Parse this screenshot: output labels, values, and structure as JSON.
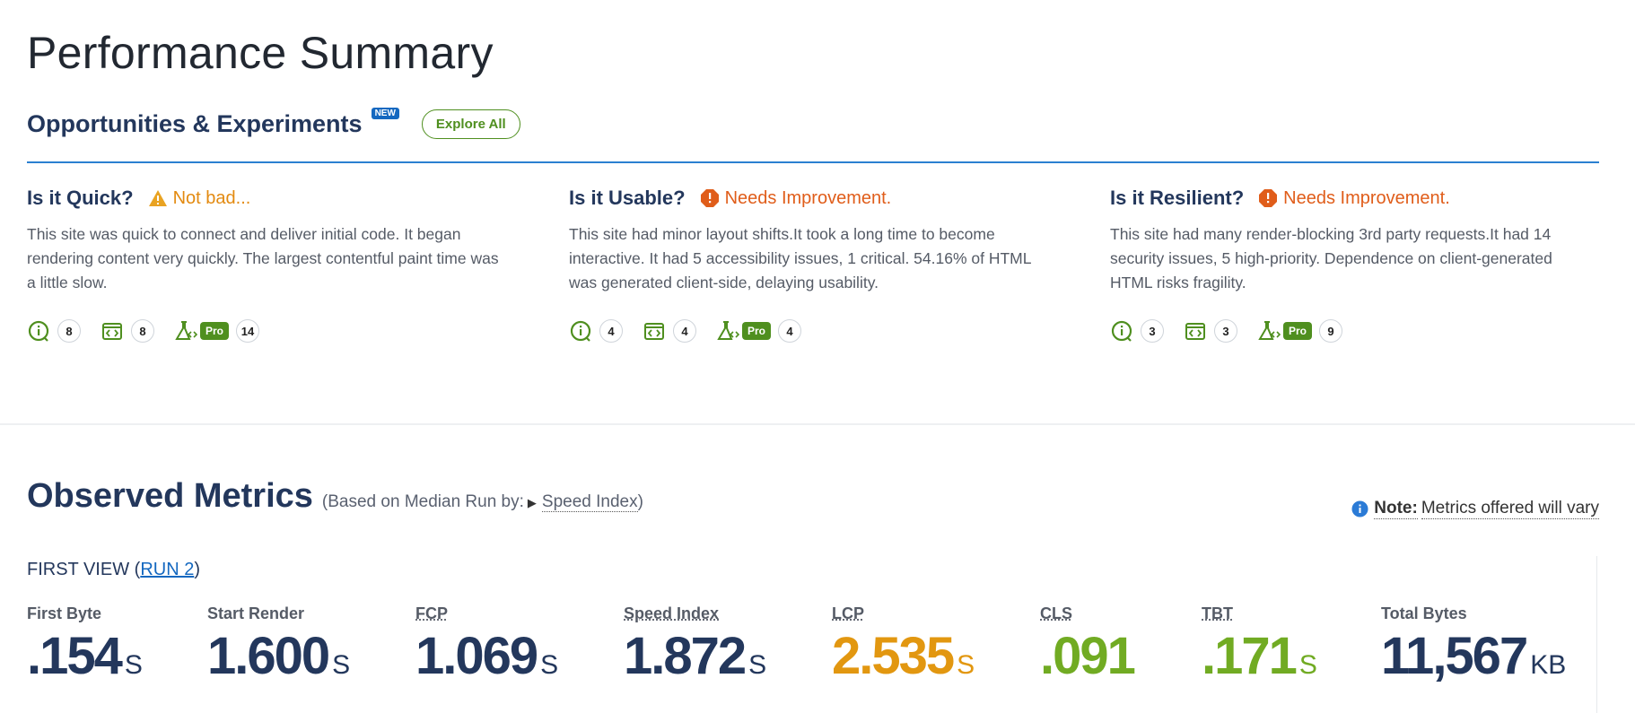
{
  "page_title": "Performance Summary",
  "opportunities": {
    "title": "Opportunities & Experiments",
    "badge": "NEW",
    "explore_label": "Explore All"
  },
  "columns": [
    {
      "heading": "Is it Quick?",
      "status": "Not bad...",
      "status_type": "warning",
      "description": "This site was quick to connect and deliver initial code. It began rendering content very quickly. The largest contentful paint time was a little slow.",
      "counts": {
        "info": "8",
        "code": "8",
        "experiments": "14"
      }
    },
    {
      "heading": "Is it Usable?",
      "status": "Needs Improvement.",
      "status_type": "error",
      "description": "This site had minor layout shifts.It took a long time to become interactive. It had 5 accessibility issues, 1 critical. 54.16% of HTML was generated client-side, delaying usability.",
      "counts": {
        "info": "4",
        "code": "4",
        "experiments": "4"
      }
    },
    {
      "heading": "Is it Resilient?",
      "status": "Needs Improvement.",
      "status_type": "error",
      "description": "This site had many render-blocking 3rd party requests.It had 14 security issues, 5 high-priority. Dependence on client-generated HTML risks fragility.",
      "counts": {
        "info": "3",
        "code": "3",
        "experiments": "9"
      }
    }
  ],
  "pro_label": "Pro",
  "observed": {
    "title": "Observed Metrics",
    "subtitle_prefix": "(Based on Median Run by:",
    "subtitle_link": "Speed Index",
    "subtitle_suffix": ")",
    "note_label": "Note:",
    "note_text": "Metrics offered will vary",
    "first_view_prefix": "FIRST VIEW (",
    "first_view_link": "RUN 2",
    "first_view_suffix": ")"
  },
  "metrics": [
    {
      "label": "First Byte",
      "value": ".154",
      "unit": "S",
      "color": "#23375c"
    },
    {
      "label": "Start Render",
      "value": "1.600",
      "unit": "S",
      "color": "#23375c"
    },
    {
      "label": "FCP",
      "value": "1.069",
      "unit": "S",
      "color": "#23375c"
    },
    {
      "label": "Speed Index",
      "value": "1.872",
      "unit": "S",
      "color": "#23375c"
    },
    {
      "label": "LCP",
      "value": "2.535",
      "unit": "S",
      "color": "#e29710"
    },
    {
      "label": "CLS",
      "value": ".091",
      "unit": "",
      "color": "#71ab23"
    },
    {
      "label": "TBT",
      "value": ".171",
      "unit": "S",
      "color": "#71ab23"
    },
    {
      "label": "Total Bytes",
      "value": "11,567",
      "unit": "KB",
      "color": "#23375c"
    }
  ],
  "colors": {
    "accent_blue": "#2b80d1",
    "green": "#4f8f1f",
    "navy": "#23375c",
    "warn": "#e38a10",
    "error": "#e05d1a"
  }
}
